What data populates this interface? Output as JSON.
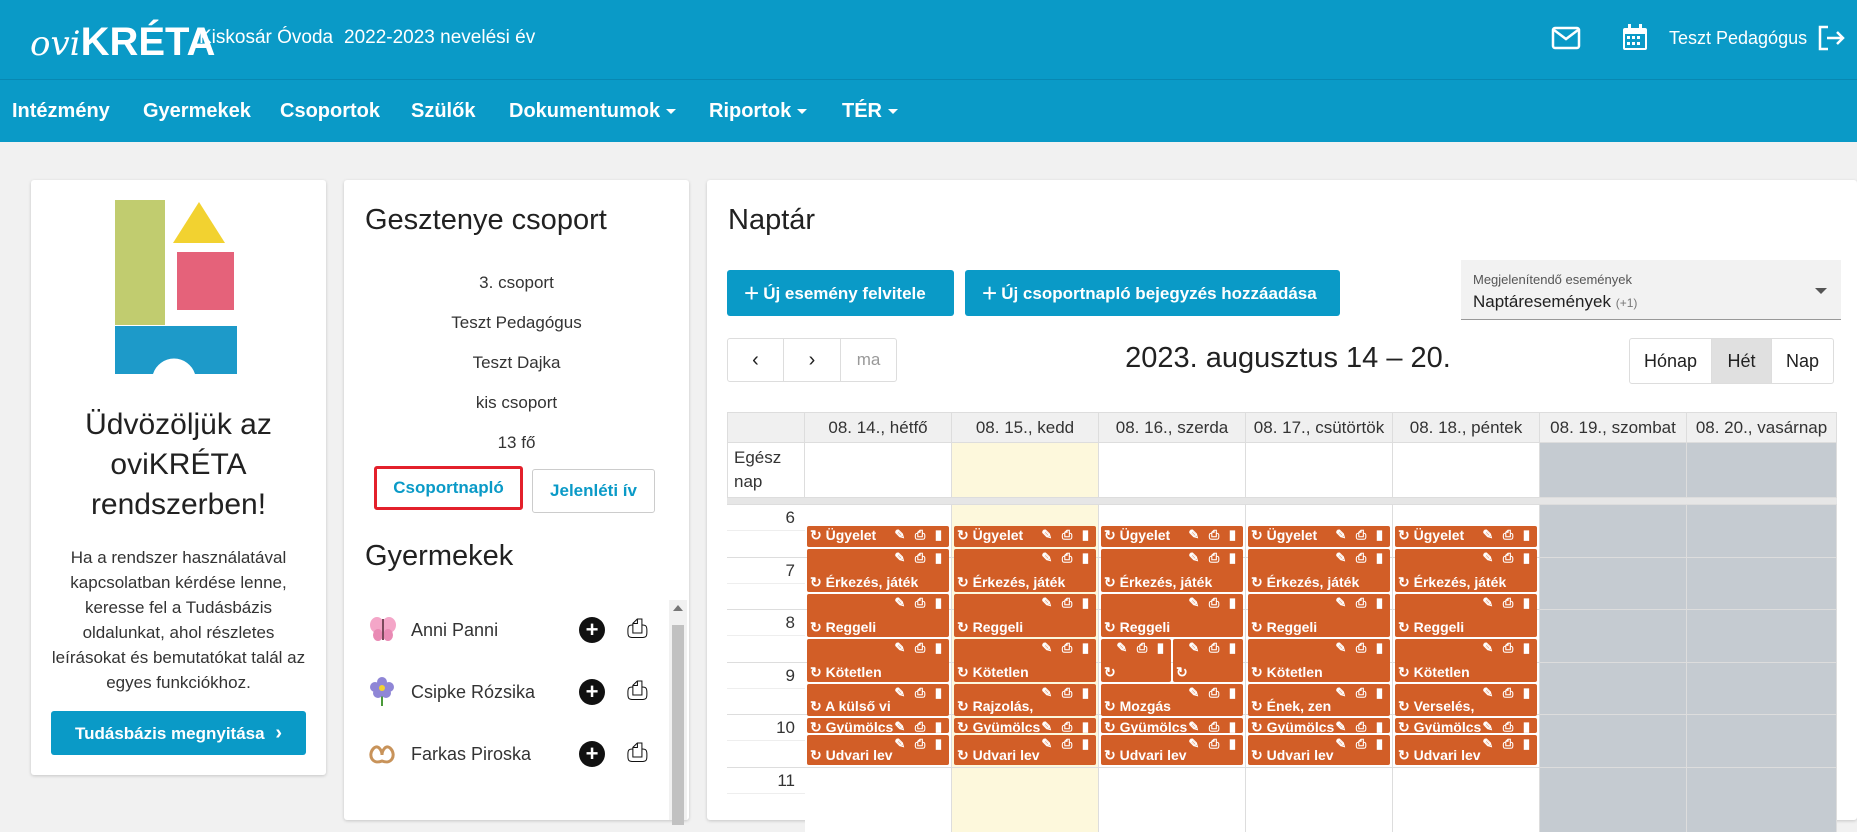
{
  "header": {
    "logo": "oviKRÉTA",
    "institution": "Kiskosár Óvoda",
    "year": "2022-2023 nevelési év",
    "user": "Teszt Pedagógus"
  },
  "nav": [
    {
      "label": "Intézmény",
      "dropdown": false
    },
    {
      "label": "Gyermekek",
      "dropdown": false
    },
    {
      "label": "Csoportok",
      "dropdown": false
    },
    {
      "label": "Szülők",
      "dropdown": false
    },
    {
      "label": "Dokumentumok",
      "dropdown": true
    },
    {
      "label": "Riportok",
      "dropdown": true
    },
    {
      "label": "TÉR",
      "dropdown": true
    }
  ],
  "welcome": {
    "title": "Üdvözöljük az oviKRÉTA rendszerben!",
    "text": "Ha a rendszer használatával kapcsolatban kérdése lenne, keresse fel a Tudásbázis oldalunkat, ahol részletes leírásokat és bemutatókat talál az egyes funkciókhoz.",
    "button": "Tudásbázis megnyitása"
  },
  "group": {
    "title": "Gesztenye csoport",
    "info": [
      "3. csoport",
      "Teszt Pedagógus",
      "Teszt Dajka",
      "kis csoport",
      "13 fő"
    ],
    "btn_journal": "Csoportnapló",
    "btn_attendance": "Jelenléti ív",
    "children_title": "Gyermekek",
    "children": [
      {
        "name": "Anni Panni",
        "icon": "butterfly-icon"
      },
      {
        "name": "Csipke Rózsika",
        "icon": "flower-icon"
      },
      {
        "name": "Farkas Piroska",
        "icon": "pretzel-icon"
      }
    ]
  },
  "calendar": {
    "title": "Naptár",
    "btn_new_event": "Új esemény felvitele",
    "btn_new_journal": "Új csoportnapló bejegyzés hozzáadása",
    "filter_label": "Megjelenítendő események",
    "filter_value": "Naptáresemények",
    "filter_extra": "(+1)",
    "today": "ma",
    "range": "2023. augusztus 14 – 20.",
    "views": [
      "Hónap",
      "Hét",
      "Nap"
    ],
    "active_view": "Hét",
    "allday_label": "Egész nap",
    "days": [
      "08. 14., hétfő",
      "08. 15., kedd",
      "08. 16., szerda",
      "08. 17., csütörtök",
      "08. 18., péntek",
      "08. 19., szombat",
      "08. 20., vasárnap"
    ],
    "hours": [
      "6",
      "7",
      "8",
      "9",
      "10",
      "11"
    ],
    "events": {
      "ugyelet": "Ügyelet",
      "erkezes": "Érkezés, játék",
      "reggeli": "Reggeli",
      "kotetlen": "Kötetlen",
      "row10": [
        "A külső vi",
        "Rajzolás,",
        "Mozgás",
        "Ének, zen",
        "Verselés,"
      ],
      "gyumolcs": "Gyümölcs",
      "udvari": "Udvari lev"
    },
    "colors": {
      "event": "#d25e27",
      "today": "#fdf8dc",
      "weekend": "#c5cbd1"
    }
  }
}
